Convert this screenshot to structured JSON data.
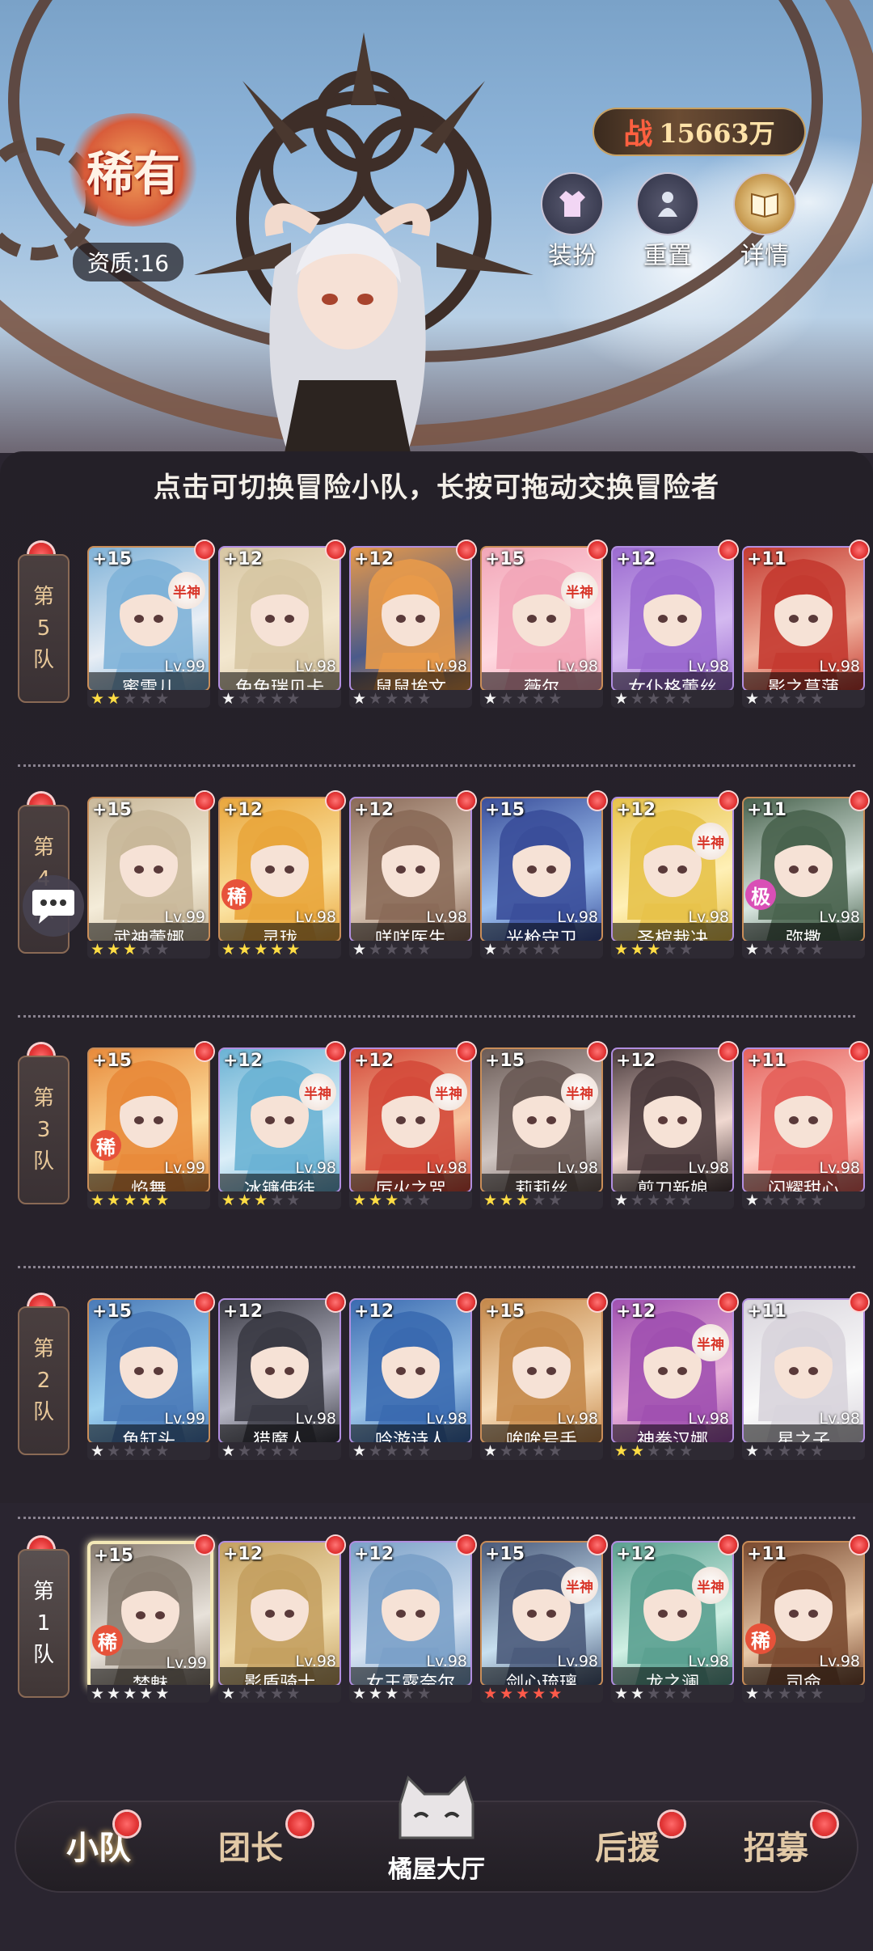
{
  "hero": {
    "rarity_label": "稀有",
    "aptitude": "资质:16",
    "power_prefix": "战",
    "power_value": "15663万",
    "buttons": [
      {
        "label": "装扮",
        "icon": "dress-icon"
      },
      {
        "label": "重置",
        "icon": "reset-icon"
      },
      {
        "label": "详情",
        "icon": "book-icon"
      }
    ]
  },
  "hint": "点击可切换冒险小队，长按可拖动交换冒险者",
  "teams": [
    {
      "label_chars": [
        "第",
        "5",
        "队"
      ],
      "heroes": [
        {
          "plus": "+15",
          "level": "Lv.99",
          "name": "蜜雪儿",
          "stars": 2,
          "star_color": "yellow",
          "badge": "半神",
          "tag": "",
          "colors": [
            "#7fb2d8",
            "#e8eef5"
          ]
        },
        {
          "plus": "+12",
          "level": "Lv.98",
          "name": "兔兔瑞贝卡",
          "stars": 1,
          "star_color": "white",
          "badge": "",
          "tag": "",
          "colors": [
            "#d7c6a3",
            "#f3e7cf"
          ]
        },
        {
          "plus": "+12",
          "level": "Lv.98",
          "name": "鼠鼠埃文",
          "stars": 1,
          "star_color": "white",
          "badge": "",
          "tag": "",
          "colors": [
            "#e89a4a",
            "#4a5a8a"
          ]
        },
        {
          "plus": "+15",
          "level": "Lv.98",
          "name": "薇尔",
          "stars": 1,
          "star_color": "white",
          "badge": "半神",
          "tag": "",
          "colors": [
            "#f2a6b8",
            "#ffd9e0"
          ]
        },
        {
          "plus": "+12",
          "level": "Lv.98",
          "name": "女仆格蕾丝",
          "stars": 1,
          "star_color": "white",
          "badge": "",
          "tag": "",
          "colors": [
            "#9b6ad0",
            "#d4b9f0"
          ]
        },
        {
          "plus": "+11",
          "level": "Lv.98",
          "name": "影之菖蒲",
          "stars": 1,
          "star_color": "white",
          "badge": "",
          "tag": "",
          "colors": [
            "#c43a30",
            "#f1b4a0"
          ]
        }
      ]
    },
    {
      "label_chars": [
        "第",
        "4",
        "队"
      ],
      "heroes": [
        {
          "plus": "+15",
          "level": "Lv.99",
          "name": "武神蕾娜",
          "stars": 3,
          "star_color": "yellow",
          "badge": "",
          "tag": "",
          "colors": [
            "#c9b89a",
            "#f4ecd9"
          ]
        },
        {
          "plus": "+12",
          "level": "Lv.98",
          "name": "灵珑",
          "stars": 5,
          "star_color": "yellow",
          "badge": "",
          "tag": "稀",
          "colors": [
            "#e9a63c",
            "#fbe3a2"
          ]
        },
        {
          "plus": "+12",
          "level": "Lv.98",
          "name": "咩咩医生",
          "stars": 1,
          "star_color": "white",
          "badge": "",
          "tag": "",
          "colors": [
            "#8a6a58",
            "#dac7b6"
          ]
        },
        {
          "plus": "+15",
          "level": "Lv.98",
          "name": "光枪守卫",
          "stars": 1,
          "star_color": "white",
          "badge": "",
          "tag": "",
          "colors": [
            "#3a4e9a",
            "#9ec2f0"
          ]
        },
        {
          "plus": "+12",
          "level": "Lv.98",
          "name": "圣棺裁决",
          "stars": 3,
          "star_color": "yellow",
          "badge": "半神",
          "tag": "",
          "colors": [
            "#e7c24a",
            "#fff0b6"
          ]
        },
        {
          "plus": "+11",
          "level": "Lv.98",
          "name": "弥撒",
          "stars": 1,
          "star_color": "white",
          "badge": "",
          "tag": "极",
          "colors": [
            "#49634e",
            "#d9e6e0"
          ]
        }
      ]
    },
    {
      "label_chars": [
        "第",
        "3",
        "队"
      ],
      "heroes": [
        {
          "plus": "+15",
          "level": "Lv.99",
          "name": "焰舞",
          "stars": 5,
          "star_color": "yellow",
          "badge": "",
          "tag": "稀",
          "colors": [
            "#e88a3a",
            "#fde0a0"
          ]
        },
        {
          "plus": "+12",
          "level": "Lv.98",
          "name": "冰镰使徒",
          "stars": 3,
          "star_color": "yellow",
          "badge": "半神",
          "tag": "",
          "colors": [
            "#6ab2d4",
            "#dbeef8"
          ]
        },
        {
          "plus": "+12",
          "level": "Lv.98",
          "name": "厉火之咒",
          "stars": 3,
          "star_color": "yellow",
          "badge": "半神",
          "tag": "",
          "colors": [
            "#d44a3a",
            "#f8c5a0"
          ]
        },
        {
          "plus": "+15",
          "level": "Lv.98",
          "name": "莉莉丝",
          "stars": 3,
          "star_color": "yellow",
          "badge": "半神",
          "tag": "",
          "colors": [
            "#6a5a55",
            "#d0c6c2"
          ]
        },
        {
          "plus": "+12",
          "level": "Lv.98",
          "name": "剪刀新娘",
          "stars": 1,
          "star_color": "white",
          "badge": "",
          "tag": "",
          "colors": [
            "#4a3a3c",
            "#f0d8d0"
          ]
        },
        {
          "plus": "+11",
          "level": "Lv.98",
          "name": "闪耀甜心",
          "stars": 1,
          "star_color": "white",
          "badge": "",
          "tag": "",
          "colors": [
            "#e4605a",
            "#ffd0c8"
          ]
        }
      ]
    },
    {
      "label_chars": [
        "第",
        "2",
        "队"
      ],
      "heroes": [
        {
          "plus": "+15",
          "level": "Lv.99",
          "name": "鱼缸头",
          "stars": 1,
          "star_color": "white",
          "badge": "",
          "tag": "",
          "colors": [
            "#4a7ab8",
            "#9ed2f0"
          ]
        },
        {
          "plus": "+12",
          "level": "Lv.98",
          "name": "猎魔人",
          "stars": 1,
          "star_color": "white",
          "badge": "",
          "tag": "",
          "colors": [
            "#3a3a44",
            "#b8b8c6"
          ]
        },
        {
          "plus": "+12",
          "level": "Lv.98",
          "name": "吟游诗人",
          "stars": 1,
          "star_color": "white",
          "badge": "",
          "tag": "",
          "colors": [
            "#3a6ab0",
            "#a0c8ea"
          ]
        },
        {
          "plus": "+15",
          "level": "Lv.98",
          "name": "哞哞号手",
          "stars": 1,
          "star_color": "white",
          "badge": "",
          "tag": "",
          "colors": [
            "#c4884a",
            "#f7dcb8"
          ]
        },
        {
          "plus": "+12",
          "level": "Lv.98",
          "name": "神拳汉娜",
          "stars": 2,
          "star_color": "yellow",
          "badge": "半神",
          "tag": "",
          "colors": [
            "#a050b0",
            "#e8b0d8"
          ]
        },
        {
          "plus": "+11",
          "level": "Lv.98",
          "name": "星之子",
          "stars": 1,
          "star_color": "white",
          "badge": "",
          "tag": "",
          "colors": [
            "#d8d4dc",
            "#fafafa"
          ]
        }
      ]
    },
    {
      "label_chars": [
        "第",
        "1",
        "队"
      ],
      "heroes": [
        {
          "plus": "+15",
          "level": "Lv.99",
          "name": "梦魅",
          "stars": 5,
          "star_color": "white",
          "badge": "",
          "tag": "稀",
          "colors": [
            "#8a7e72",
            "#e8e2da"
          ]
        },
        {
          "plus": "+12",
          "level": "Lv.98",
          "name": "影盾骑士",
          "stars": 1,
          "star_color": "white",
          "badge": "",
          "tag": "",
          "colors": [
            "#c4a060",
            "#f2e0b4"
          ]
        },
        {
          "plus": "+12",
          "level": "Lv.98",
          "name": "女王露奈尔",
          "stars": 3,
          "star_color": "white",
          "badge": "",
          "tag": "",
          "colors": [
            "#7aa0c8",
            "#d8e4f2"
          ]
        },
        {
          "plus": "+15",
          "level": "Lv.98",
          "name": "剑心琉璃",
          "stars": 5,
          "star_color": "red",
          "badge": "半神",
          "tag": "",
          "colors": [
            "#4a5a7a",
            "#c8e0f0"
          ]
        },
        {
          "plus": "+12",
          "level": "Lv.98",
          "name": "龙之澜",
          "stars": 2,
          "star_color": "white",
          "badge": "半神",
          "tag": "",
          "colors": [
            "#5aa090",
            "#d0f0e4"
          ]
        },
        {
          "plus": "+11",
          "level": "Lv.98",
          "name": "司命",
          "stars": 1,
          "star_color": "white",
          "badge": "",
          "tag": "稀",
          "colors": [
            "#7a4a30",
            "#e8c8a8"
          ]
        }
      ]
    }
  ],
  "nav": {
    "items": [
      "小队",
      "团长",
      "后援",
      "招募"
    ],
    "center_label": "橘屋大厅"
  }
}
